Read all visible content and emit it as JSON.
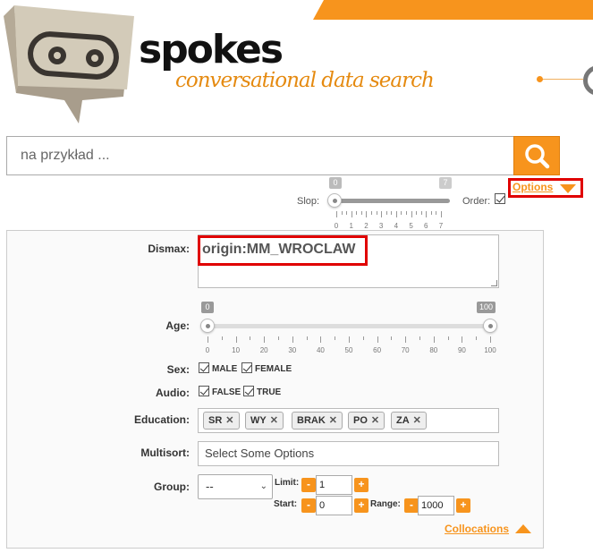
{
  "header": {
    "brand": "spokes",
    "tagline": "conversational data search",
    "accent_color": "#f7941d"
  },
  "search": {
    "placeholder": "na przykład ...",
    "button_icon": "search-icon"
  },
  "slop": {
    "label": "Slop:",
    "min_badge": "0",
    "max_badge": "7",
    "value": 0,
    "max": 7,
    "ticks": [
      "0",
      "1",
      "2",
      "3",
      "4",
      "5",
      "6",
      "7"
    ]
  },
  "order": {
    "label": "Order:",
    "checked": true
  },
  "options_link": "Options",
  "form": {
    "dismax": {
      "label": "Dismax:",
      "value": "origin:MM_WROCLAW"
    },
    "age": {
      "label": "Age:",
      "min_badge": "0",
      "max_badge": "100",
      "ticks": [
        "0",
        "10",
        "20",
        "30",
        "40",
        "50",
        "60",
        "70",
        "80",
        "90",
        "100"
      ]
    },
    "sex": {
      "label": "Sex:",
      "options": [
        {
          "label": "MALE",
          "checked": true
        },
        {
          "label": "FEMALE",
          "checked": true
        }
      ]
    },
    "audio": {
      "label": "Audio:",
      "options": [
        {
          "label": "FALSE",
          "checked": true
        },
        {
          "label": "TRUE",
          "checked": true
        }
      ]
    },
    "education": {
      "label": "Education:",
      "tags": [
        "SR",
        "WY",
        "BRAK",
        "PO",
        "ZA"
      ]
    },
    "multisort": {
      "label": "Multisort:",
      "placeholder": "Select Some Options"
    },
    "group": {
      "label": "Group:",
      "value": "--"
    },
    "limit": {
      "label": "Limit:",
      "value": "1"
    },
    "start": {
      "label": "Start:",
      "value": "0"
    },
    "range": {
      "label": "Range:",
      "value": "1000"
    },
    "minus": "-",
    "plus": "+"
  },
  "collocations_link": "Collocations"
}
